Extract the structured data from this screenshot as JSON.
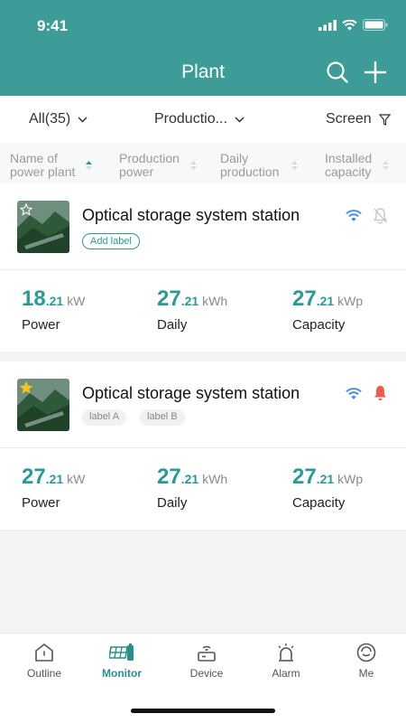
{
  "status_bar": {
    "time": "9:41"
  },
  "header": {
    "title": "Plant",
    "search_icon": "search-icon",
    "add_icon": "plus-icon"
  },
  "filters": {
    "all": "All(35)",
    "production": "Productio...",
    "screen": "Screen"
  },
  "sort": {
    "name": "Name of power plant",
    "power": "Production power",
    "daily": "Daily production",
    "capacity": "Installed capacity"
  },
  "stations": [
    {
      "name": "Optical storage system station",
      "favorite": false,
      "labels": [
        "Add label"
      ],
      "alarm": false,
      "power": {
        "int": "18",
        "dec": ".21",
        "unit": "kW",
        "label": "Power"
      },
      "daily": {
        "int": "27",
        "dec": ".21",
        "unit": "kWh",
        "label": "Daily"
      },
      "capacity": {
        "int": "27",
        "dec": ".21",
        "unit": "kWp",
        "label": "Capacity"
      }
    },
    {
      "name": "Optical storage system station",
      "favorite": true,
      "labels": [
        "label A",
        "label B"
      ],
      "alarm": true,
      "power": {
        "int": "27",
        "dec": ".21",
        "unit": "kW",
        "label": "Power"
      },
      "daily": {
        "int": "27",
        "dec": ".21",
        "unit": "kWh",
        "label": "Daily"
      },
      "capacity": {
        "int": "27",
        "dec": ".21",
        "unit": "kWp",
        "label": "Capacity"
      }
    }
  ],
  "tabs": [
    "Outline",
    "Monitor",
    "Device",
    "Alarm",
    "Me"
  ],
  "colors": {
    "primary": "#3d9c98",
    "accent": "#2a9a96",
    "wifi": "#4a8fe0",
    "alarm": "#f05a4a"
  }
}
